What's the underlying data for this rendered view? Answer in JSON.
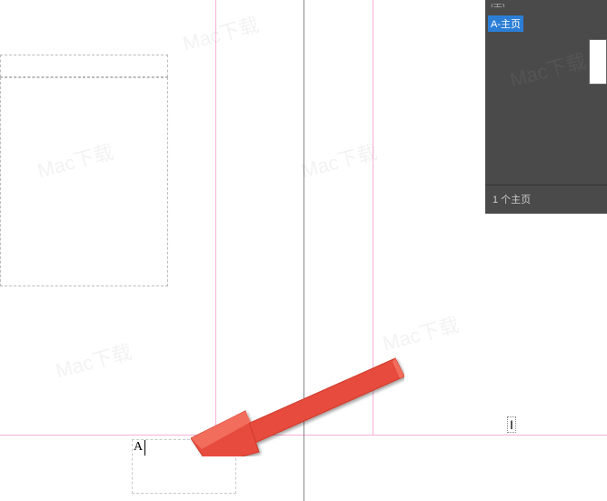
{
  "canvas": {
    "text_frame_content": "A"
  },
  "panel": {
    "top_row": "[无]",
    "master_item": "A-主页",
    "footer": "1 个主页"
  },
  "cursor": {
    "ibeam": "I"
  },
  "watermark": {
    "text": "Mac下载"
  },
  "colors": {
    "highlight": "#2b7ed6",
    "arrow": "#e74c3c",
    "guide": "#e91e8f",
    "panel_bg": "#4a4a4a"
  }
}
